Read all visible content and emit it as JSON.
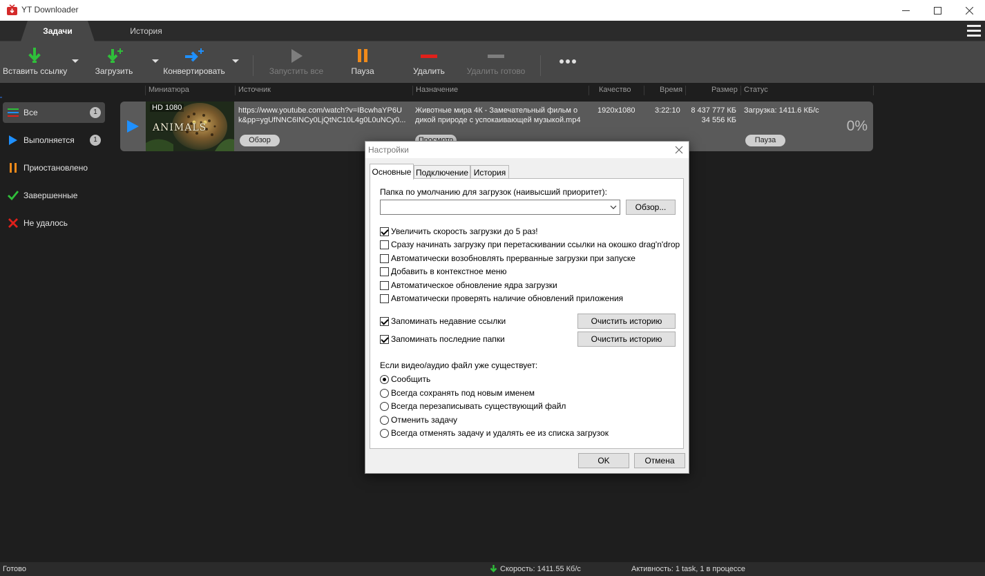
{
  "window": {
    "title": "YT Downloader"
  },
  "tabs": [
    {
      "label": "Задачи"
    },
    {
      "label": "История"
    }
  ],
  "toolbar": {
    "paste_link": "Вставить ссылку",
    "download": "Загрузить",
    "convert": "Конвертировать",
    "start_all": "Запустить все",
    "pause": "Пауза",
    "delete": "Удалить",
    "delete_done": "Удалить готово"
  },
  "columns": {
    "thumbnail": "Миниатюра",
    "source": "Источник",
    "destination": "Назначение",
    "quality": "Качество",
    "time": "Время",
    "size": "Размер",
    "status": "Статус"
  },
  "sidebar": {
    "items": [
      {
        "label": "Все",
        "count": "1"
      },
      {
        "label": "Выполняется",
        "count": "1"
      },
      {
        "label": "Приостановлено"
      },
      {
        "label": "Завершенные"
      },
      {
        "label": "Не удалось"
      }
    ]
  },
  "task": {
    "badge": "HD 1080",
    "thumb_title": "ANIMALS",
    "source_line1": "https://www.youtube.com/watch?v=IBcwhaYP6U",
    "source_line2": "k&pp=ygUfNNC6INCy0LjQtNC10L4g0L0uNCy0...",
    "dest_line1": "Животные мира 4К - Замечательный фильм о",
    "dest_line2": "дикой природе с успокаивающей музыкой.mp4",
    "quality": "1920x1080",
    "time": "3:22:10",
    "size_total": "8 437 777 КБ",
    "size_done": "34 556 КБ",
    "status": "Загрузка: 1411.6 КБ/с",
    "percent": "0%",
    "browse_btn": "Обзор",
    "preview_btn": "Просмотр",
    "pause_btn": "Пауза"
  },
  "statusbar": {
    "state": "Готово",
    "speed": "Скорость: 1411.55 Кб/с",
    "activity": "Активность: 1 task, 1 в процессе"
  },
  "dialog": {
    "title": "Настройки",
    "tabs": [
      {
        "label": "Основные"
      },
      {
        "label": "Подключение"
      },
      {
        "label": "История"
      }
    ],
    "folder_label": "Папка по умолчанию для загрузок (наивысший приоритет):",
    "folder_value": "",
    "browse_btn": "Обзор...",
    "checkboxes": [
      {
        "label": "Увеличить скорость загрузки до 5 раз!",
        "checked": true
      },
      {
        "label": "Сразу начинать загрузку при перетаскивании ссылки на окошко drag'n'drop",
        "checked": false
      },
      {
        "label": "Автоматически возобновлять прерванные загрузки при запуске",
        "checked": false
      },
      {
        "label": "Добавить в контекстное меню",
        "checked": false
      },
      {
        "label": "Автоматическое обновление ядра загрузки",
        "checked": false
      },
      {
        "label": "Автоматически проверять наличие обновлений приложения",
        "checked": false
      }
    ],
    "remember": [
      {
        "label": "Запоминать недавние ссылки",
        "checked": true,
        "button": "Очистить историю"
      },
      {
        "label": "Запоминать последние папки",
        "checked": true,
        "button": "Очистить историю"
      }
    ],
    "exists_label": "Если видео/аудио файл уже существует:",
    "radios": [
      {
        "label": "Сообщить",
        "checked": true
      },
      {
        "label": "Всегда сохранять под новым именем",
        "checked": false
      },
      {
        "label": "Всегда перезаписывать существующий файл",
        "checked": false
      },
      {
        "label": "Отменить задачу",
        "checked": false
      },
      {
        "label": "Всегда отменять задачу и удалять ее из списка загрузок",
        "checked": false
      }
    ],
    "ok": "OK",
    "cancel": "Отмена"
  },
  "colors": {
    "green": "#2fbf3a",
    "blue": "#1e90ff",
    "orange": "#f08a1a",
    "red": "#e0201a"
  }
}
